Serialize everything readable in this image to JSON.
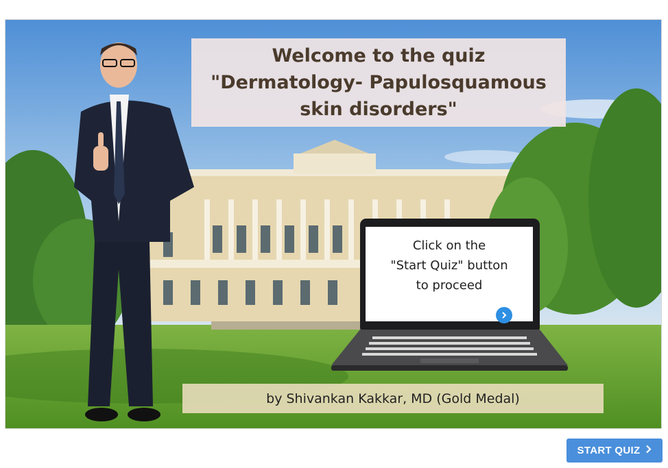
{
  "welcome": {
    "line1": "Welcome to the quiz",
    "line2": "\"Dermatology- Papulosquamous",
    "line3": "skin disorders\""
  },
  "laptop_screen": {
    "line1": "Click on the",
    "line2": "\"Start Quiz\" button",
    "line3": "to proceed",
    "next_icon": "chevron-right-icon"
  },
  "author": "by Shivankan Kakkar, MD (Gold Medal)",
  "start_button": {
    "label": "START QUIZ",
    "icon": "chevron-right-icon"
  },
  "colors": {
    "start_button": "#4a8fdb",
    "next_circle": "#2e8fe2",
    "title_text": "#4a3b2c"
  }
}
